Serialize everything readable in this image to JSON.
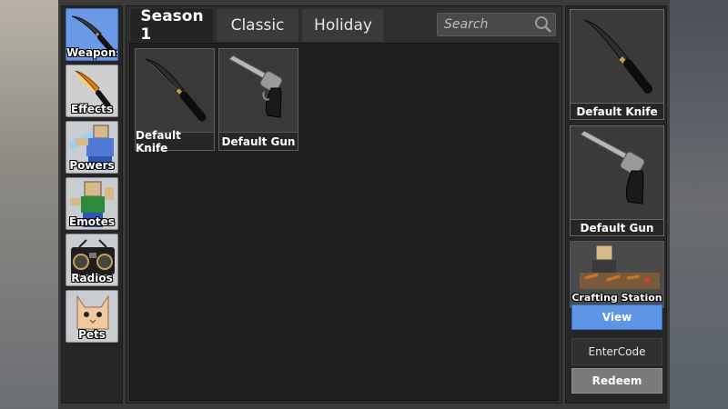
{
  "sidebar": {
    "items": [
      {
        "label": "Weapons",
        "icon": "knife-icon",
        "active": true
      },
      {
        "label": "Effects",
        "icon": "flame-knife-icon",
        "active": false
      },
      {
        "label": "Powers",
        "icon": "power-avatar-icon",
        "active": false
      },
      {
        "label": "Emotes",
        "icon": "emote-avatar-icon",
        "active": false
      },
      {
        "label": "Radios",
        "icon": "boombox-icon",
        "active": false
      },
      {
        "label": "Pets",
        "icon": "cat-pet-icon",
        "active": false
      }
    ]
  },
  "tabs": [
    {
      "label": "Season 1",
      "active": true
    },
    {
      "label": "Classic",
      "active": false
    },
    {
      "label": "Holiday",
      "active": false
    }
  ],
  "search": {
    "placeholder": "Search",
    "value": ""
  },
  "inventory": {
    "items": [
      {
        "name": "Default Knife",
        "icon": "knife-icon"
      },
      {
        "name": "Default Gun",
        "icon": "revolver-icon"
      }
    ]
  },
  "equipped": {
    "knife": {
      "name": "Default Knife",
      "icon": "knife-icon"
    },
    "gun": {
      "name": "Default Gun",
      "icon": "revolver-icon"
    }
  },
  "crafting": {
    "label": "Crafting Station"
  },
  "buttons": {
    "view": "View",
    "enter_code": "EnterCode",
    "redeem": "Redeem"
  },
  "colors": {
    "accent": "#5f95e6",
    "panel": "#262626",
    "grid": "#1f1f1f"
  }
}
